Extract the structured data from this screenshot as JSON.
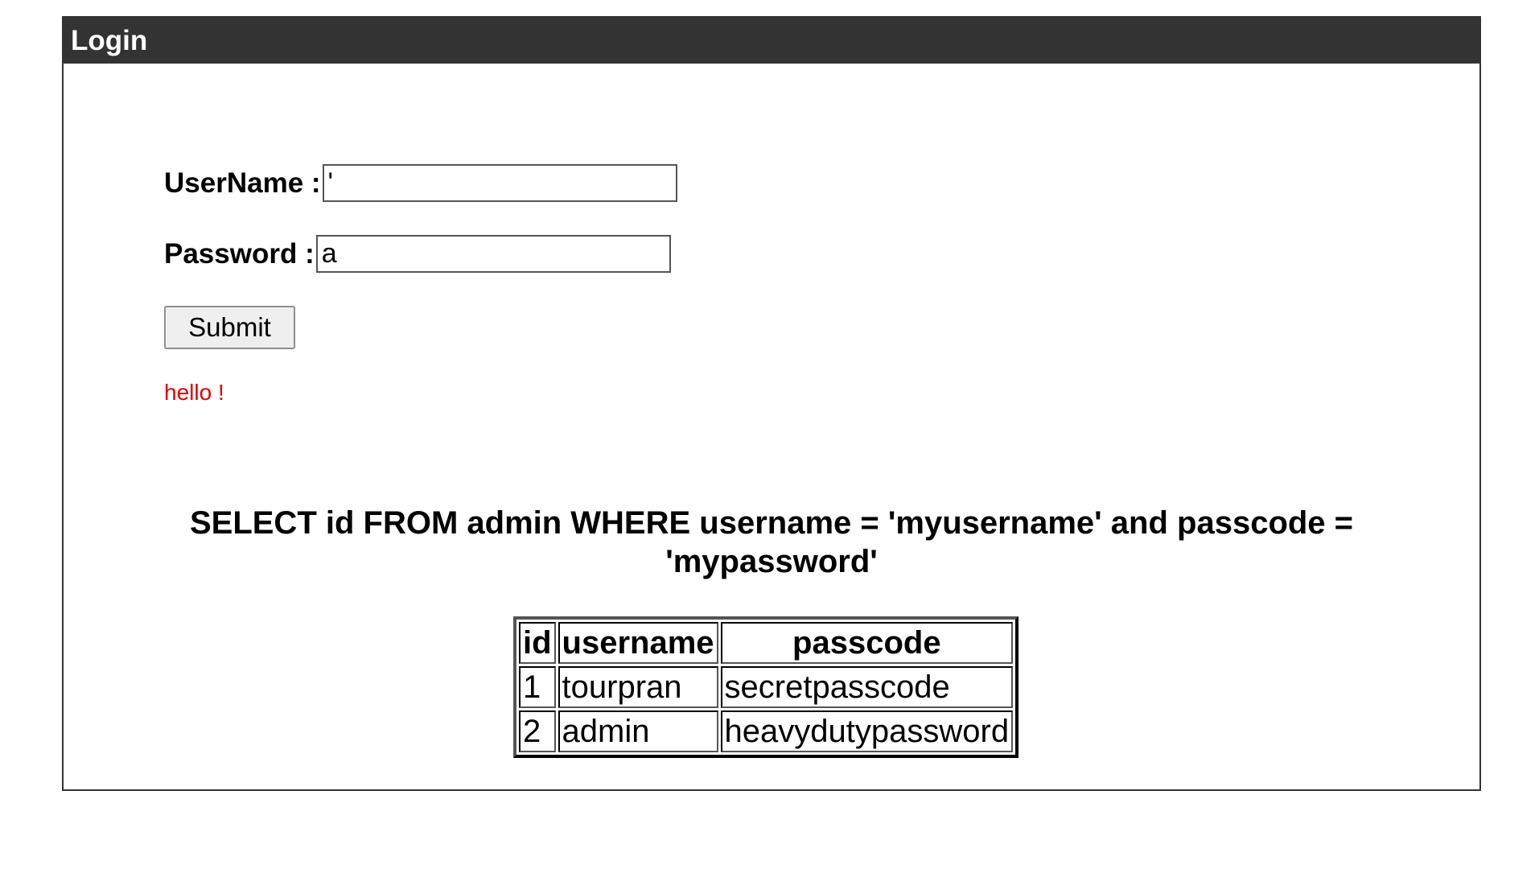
{
  "window": {
    "title": "Login"
  },
  "form": {
    "username_label": "UserName :",
    "username_value": "'",
    "password_label": "Password :",
    "password_value": "a",
    "submit_label": "Submit",
    "message": "hello !"
  },
  "query": {
    "text": "SELECT id FROM admin WHERE username = 'myusername' and passcode = 'mypassword'"
  },
  "table": {
    "headers": [
      "id",
      "username",
      "passcode"
    ],
    "rows": [
      [
        "1",
        "tourpran",
        "secretpasscode"
      ],
      [
        "2",
        "admin",
        "heavydutypassword"
      ]
    ]
  },
  "colors": {
    "titlebar": "#333333",
    "message": "#e00000"
  }
}
